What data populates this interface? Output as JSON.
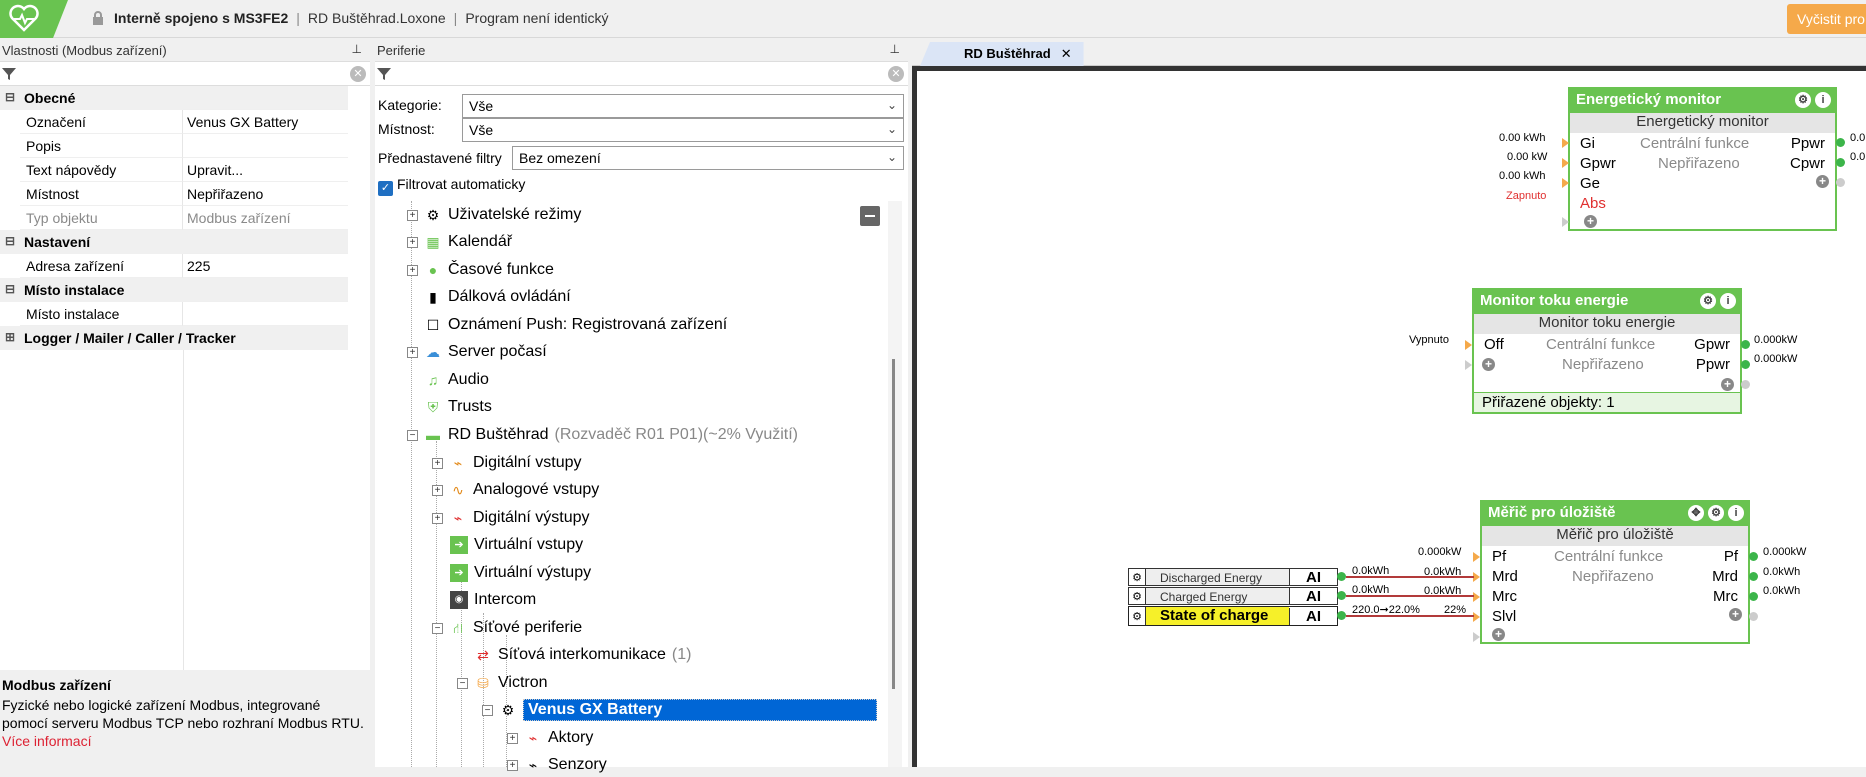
{
  "header": {
    "connection": "Interně spojeno s MS3FE2",
    "project": "RD Buštěhrad.Loxone",
    "status": "Program není identický",
    "sync_button": "Vyčistit pro"
  },
  "properties": {
    "title": "Vlastnosti (Modbus zařízení)",
    "groups": {
      "general": "Obecné",
      "settings": "Nastavení",
      "install": "Místo instalace",
      "logger": "Logger / Mailer / Caller / Tracker"
    },
    "rows": {
      "label_k": "Označení",
      "label_v": "Venus GX Battery",
      "desc_k": "Popis",
      "desc_v": "",
      "help_k": "Text nápovědy",
      "help_v": "Upravit...",
      "room_k": "Místnost",
      "room_v": "Nepřiřazeno",
      "type_k": "Typ objektu",
      "type_v": "Modbus zařízení",
      "addr_k": "Adresa zařízení",
      "addr_v": "225",
      "inst_k": "Místo instalace",
      "inst_v": ""
    },
    "description": {
      "title": "Modbus zařízení",
      "text": "Fyzické nebo logické zařízení Modbus, integrované pomocí serveru Modbus TCP nebo rozhraní Modbus RTU.",
      "link": "Více informací"
    }
  },
  "periferie": {
    "title": "Periferie",
    "category_label": "Kategorie:",
    "category_value": "Vše",
    "room_label": "Místnost:",
    "room_value": "Vše",
    "preset_label": "Přednastavené filtry",
    "preset_value": "Bez omezení",
    "auto_filter": "Filtrovat automaticky",
    "tree": {
      "user_modes": "Uživatelské režimy",
      "calendar": "Kalendář",
      "time_functions": "Časové funkce",
      "remote": "Dálková ovládání",
      "push": "Oznámení Push: Registrovaná zařízení",
      "weather": "Server počasí",
      "audio": "Audio",
      "trusts": "Trusts",
      "rd": "RD Buštěhrad",
      "rd_info": "(Rozvaděč R01 P01)(~2% Využití)",
      "dig_in": "Digitální vstupy",
      "ana_in": "Analogové vstupy",
      "dig_out": "Digitální výstupy",
      "virt_in": "Virtuální vstupy",
      "virt_out": "Virtuální výstupy",
      "intercom": "Intercom",
      "net": "Síťové periferie",
      "net_ic": "Síťová interkomunikace",
      "net_ic_count": "(1)",
      "victron": "Victron",
      "venus": "Venus GX Battery",
      "actors": "Aktory",
      "sensors": "Senzory"
    }
  },
  "canvas": {
    "tab": "RD Buštěhrad",
    "energy": {
      "title": "Energetický monitor",
      "sub": "Energetický monitor",
      "center1": "Centrální funkce",
      "center2": "Nepřiřazeno",
      "in1": "Gi",
      "in2": "Gpwr",
      "in3": "Ge",
      "in4": "Abs",
      "out1": "Ppwr",
      "out2": "Cpwr",
      "v1": "0.00 kWh",
      "v2": "0.00 kW",
      "v3": "0.00 kWh",
      "v4": "Zapnuto",
      "o1": "0.0",
      "o2": "0.0"
    },
    "flow": {
      "title": "Monitor toku energie",
      "sub": "Monitor toku energie",
      "center1": "Centrální funkce",
      "center2": "Nepřiřazeno",
      "in1": "Off",
      "out1": "Gpwr",
      "out2": "Ppwr",
      "v_in": "Vypnuto",
      "o1": "0.000kW",
      "o2": "0.000kW",
      "footer": "Přiřazené objekty: 1"
    },
    "meter": {
      "title": "Měřič pro úložiště",
      "sub": "Měřič pro úložiště",
      "center1": "Centrální funkce",
      "center2": "Nepřiřazeno",
      "in1": "Pf",
      "in2": "Mrd",
      "in3": "Mrc",
      "in4": "Slvl",
      "out1": "Pf",
      "out2": "Mrd",
      "out3": "Mrc",
      "v1": "0.000kW",
      "v2": "0.0kWh",
      "v3": "0.0kWh",
      "v4": "22%",
      "o1": "0.000kW",
      "o2": "0.0kWh",
      "o3": "0.0kWh"
    },
    "inputs": {
      "discharged": "Discharged Energy",
      "charged": "Charged Energy",
      "soc": "State of charge",
      "ai": "AI",
      "w1": "0.0kWh",
      "w2": "0.0kWh",
      "w3": "220.0➞22.0%"
    }
  }
}
